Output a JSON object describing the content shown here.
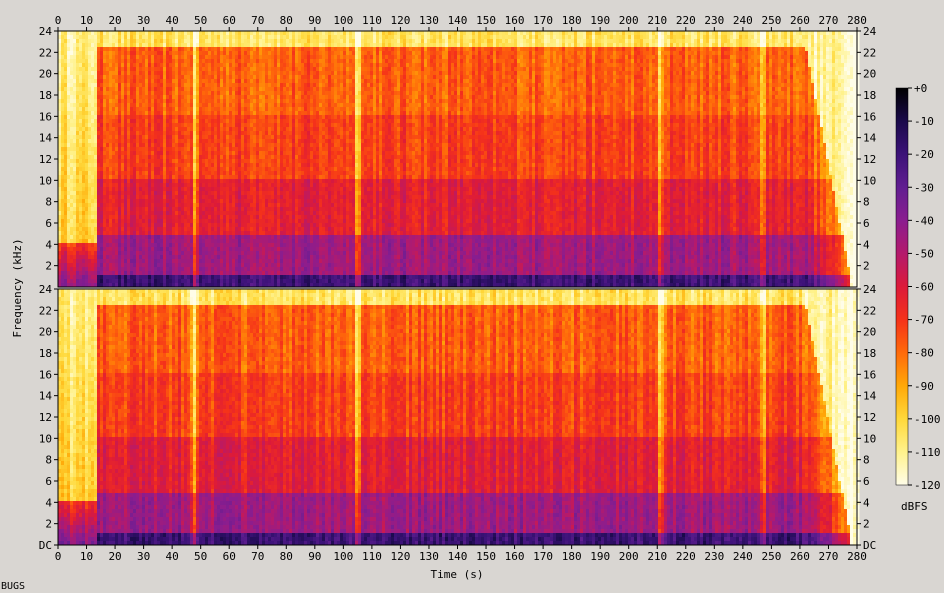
{
  "chart_data": {
    "type": "heatmap",
    "title": "",
    "xlabel": "Time (s)",
    "ylabel": "Frequency (kHz)",
    "xlim": [
      0,
      280
    ],
    "x_ticks": [
      0,
      10,
      20,
      30,
      40,
      50,
      60,
      70,
      80,
      90,
      100,
      110,
      120,
      130,
      140,
      150,
      160,
      170,
      180,
      190,
      200,
      210,
      220,
      230,
      240,
      250,
      260,
      270,
      280
    ],
    "channels": [
      {
        "name": "",
        "y_ticks": [
          {
            "v": 2,
            "t": "2"
          },
          {
            "v": 4,
            "t": "4"
          },
          {
            "v": 6,
            "t": "6"
          },
          {
            "v": 8,
            "t": "8"
          },
          {
            "v": 10,
            "t": "10"
          },
          {
            "v": 12,
            "t": "12"
          },
          {
            "v": 14,
            "t": "14"
          },
          {
            "v": 16,
            "t": "16"
          },
          {
            "v": 18,
            "t": "18"
          },
          {
            "v": 20,
            "t": "20"
          },
          {
            "v": 22,
            "t": "22"
          },
          {
            "v": 24,
            "t": "24"
          }
        ]
      },
      {
        "name": "",
        "y_ticks": [
          {
            "v": 0,
            "t": "DC"
          },
          {
            "v": 2,
            "t": "2"
          },
          {
            "v": 4,
            "t": "4"
          },
          {
            "v": 6,
            "t": "6"
          },
          {
            "v": 8,
            "t": "8"
          },
          {
            "v": 10,
            "t": "10"
          },
          {
            "v": 12,
            "t": "12"
          },
          {
            "v": 14,
            "t": "14"
          },
          {
            "v": 16,
            "t": "16"
          },
          {
            "v": 18,
            "t": "18"
          },
          {
            "v": 20,
            "t": "20"
          },
          {
            "v": 22,
            "t": "22"
          },
          {
            "v": 24,
            "t": "24"
          }
        ]
      }
    ],
    "ylim_khz": [
      0,
      24
    ],
    "colorbar": {
      "label": "dBFS",
      "range": [
        -120,
        0
      ],
      "ticks": [
        {
          "v": 0,
          "t": "+0"
        },
        {
          "v": -10,
          "t": "-10"
        },
        {
          "v": -20,
          "t": "-20"
        },
        {
          "v": -30,
          "t": "-30"
        },
        {
          "v": -40,
          "t": "-40"
        },
        {
          "v": -50,
          "t": "-50"
        },
        {
          "v": -60,
          "t": "-60"
        },
        {
          "v": -70,
          "t": "-70"
        },
        {
          "v": -80,
          "t": "-80"
        },
        {
          "v": -90,
          "t": "-90"
        },
        {
          "v": -100,
          "t": "-100"
        },
        {
          "v": -110,
          "t": "-110"
        },
        {
          "v": -120,
          "t": "-120"
        }
      ],
      "colors": [
        "#000000",
        "#1a0a4a",
        "#3c1278",
        "#611e91",
        "#8a1d8f",
        "#b41a6c",
        "#dc1a3a",
        "#f5321a",
        "#ff6a0a",
        "#ffa808",
        "#ffd83a",
        "#fff28c",
        "#fffde8"
      ]
    },
    "approx_level_db": {
      "music_start_s": 14,
      "music_end_s": 262,
      "fade_end_s": 278,
      "cutoff_khz": 22.5,
      "quiet_dips_s": [
        48,
        105,
        211,
        247
      ],
      "levels": [
        {
          "band_khz": [
            0,
            1
          ],
          "db": -20
        },
        {
          "band_khz": [
            1,
            5
          ],
          "db": -45
        },
        {
          "band_khz": [
            5,
            10
          ],
          "db": -62
        },
        {
          "band_khz": [
            10,
            16
          ],
          "db": -72
        },
        {
          "band_khz": [
            16,
            22.5
          ],
          "db": -78
        },
        {
          "band_khz": [
            22.5,
            24
          ],
          "db": -105
        }
      ]
    }
  },
  "footer": {
    "label": "BUGS"
  }
}
